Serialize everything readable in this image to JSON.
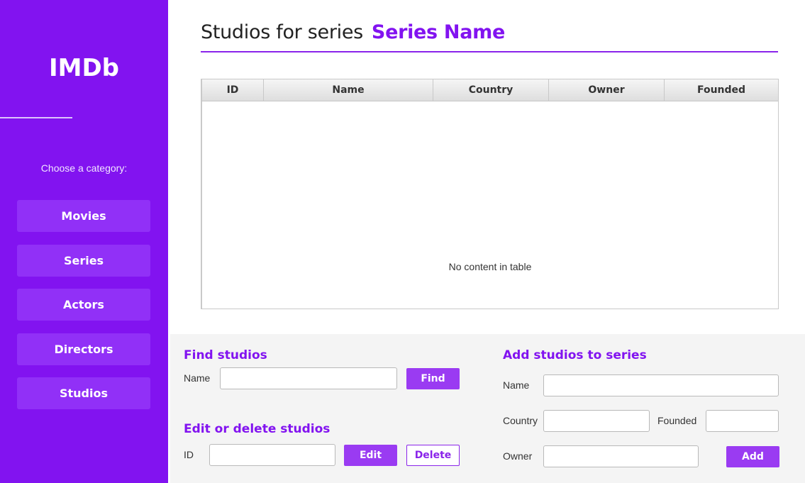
{
  "sidebar": {
    "logo": "IMDb",
    "prompt": "Choose a category:",
    "items": [
      {
        "label": "Movies"
      },
      {
        "label": "Series"
      },
      {
        "label": "Actors"
      },
      {
        "label": "Directors"
      },
      {
        "label": "Studios"
      }
    ]
  },
  "header": {
    "prefix": "Studios for series",
    "series_name": "Series Name"
  },
  "table": {
    "columns": [
      "ID",
      "Name",
      "Country",
      "Owner",
      "Founded"
    ],
    "rows": [],
    "empty_message": "No content in table"
  },
  "find": {
    "title": "Find studios",
    "name_label": "Name",
    "name_value": "",
    "button": "Find"
  },
  "edit": {
    "title": "Edit or delete studios",
    "id_label": "ID",
    "id_value": "",
    "edit_button": "Edit",
    "delete_button": "Delete"
  },
  "add": {
    "title": "Add studios to series",
    "name_label": "Name",
    "country_label": "Country",
    "founded_label": "Founded",
    "owner_label": "Owner",
    "button": "Add"
  },
  "colors": {
    "accent": "#8213f0",
    "nav_button": "#9130f7",
    "action_button": "#9a3bf2"
  }
}
